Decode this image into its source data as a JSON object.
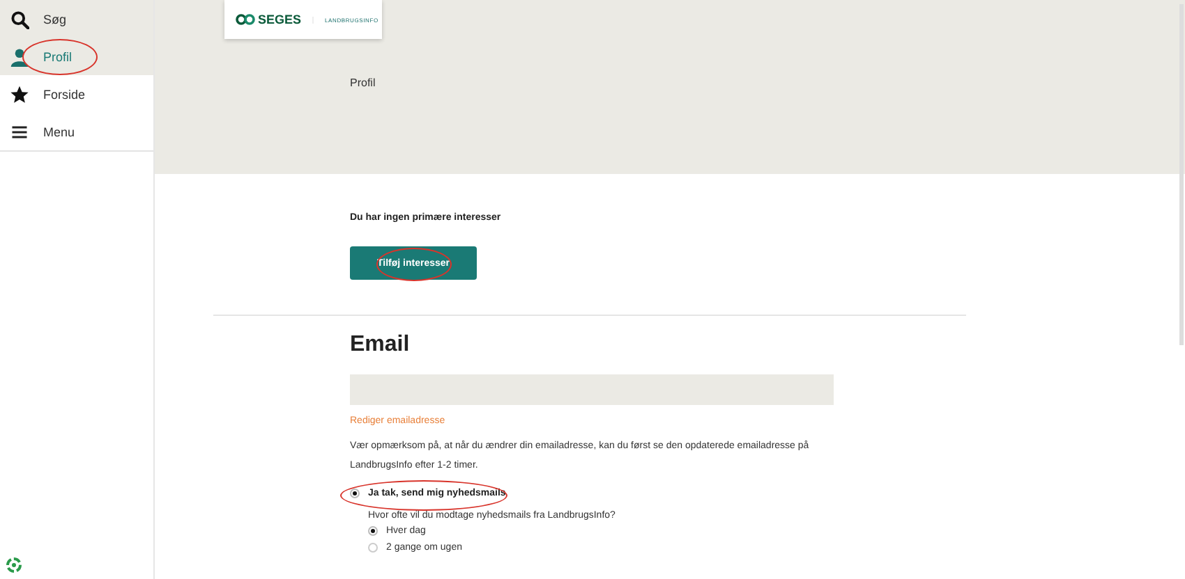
{
  "sidebar": {
    "sections": [
      {
        "kind": "tools",
        "items": [
          {
            "label": "Søg",
            "selected": false,
            "circled": false
          },
          {
            "label": "Profil",
            "selected": true,
            "circled": true
          }
        ]
      },
      {
        "kind": "nav",
        "items": [
          {
            "label": "Forside",
            "selected": false,
            "circled": false
          },
          {
            "label": "Menu",
            "selected": false,
            "circled": false
          }
        ]
      }
    ]
  },
  "header": {
    "logo": {
      "brand": "SEGES",
      "sub": "LANDBRUGSINFO"
    },
    "page_title": "Profil"
  },
  "interests": {
    "message": "Du har ingen primære interesser",
    "button": {
      "label": "Tilføj interesser",
      "circled": true
    }
  },
  "email": {
    "heading": "Email",
    "edit_link": "Rediger emailadresse",
    "notice": "Vær opmærksom på, at når du ændrer din emailadresse, kan du først se den opdaterede emailadresse på LandbrugsInfo efter 1-2 timer.",
    "newsletter": {
      "label": "Ja tak, send mig nyhedsmails",
      "selected": true,
      "circled": true
    },
    "frequency_question": "Hvor ofte vil du modtage nyhedsmails fra LandbrugsInfo?",
    "frequency_options": [
      {
        "label": "Hver dag",
        "selected": true
      },
      {
        "label": "2 gange om ugen",
        "selected": false
      }
    ]
  }
}
